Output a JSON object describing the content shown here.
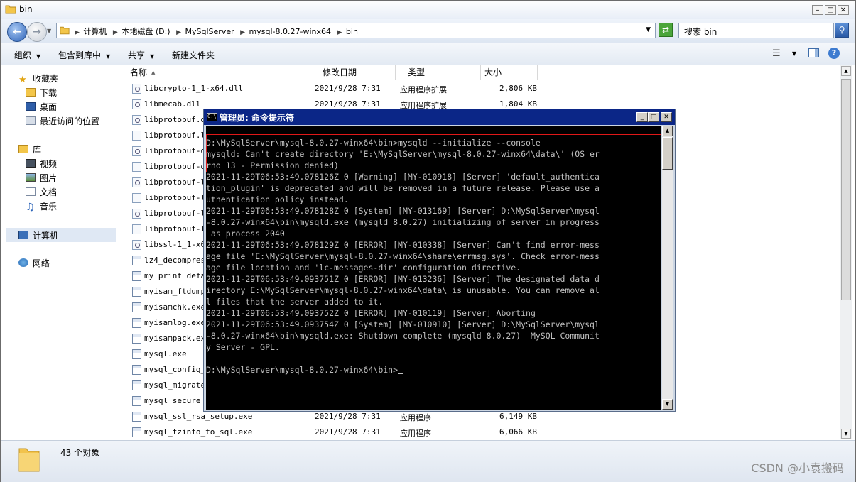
{
  "window": {
    "title": "bin",
    "controls": [
      "minimize",
      "maximize",
      "close"
    ]
  },
  "address_bar": {
    "breadcrumbs": [
      "计算机",
      "本地磁盘 (D:)",
      "MySqlServer",
      "mysql-8.0.27-winx64",
      "bin"
    ],
    "search_placeholder": "搜索 bin"
  },
  "toolbar": {
    "organize": "组织",
    "include_in_library": "包含到库中",
    "share": "共享",
    "new_folder": "新建文件夹"
  },
  "nav_pane": {
    "favorites": "收藏夹",
    "downloads": "下载",
    "desktop": "桌面",
    "recent": "最近访问的位置",
    "libraries": "库",
    "videos": "视频",
    "pictures": "图片",
    "documents": "文档",
    "music": "音乐",
    "computer": "计算机",
    "network": "网络"
  },
  "columns": {
    "name": "名称",
    "modified": "修改日期",
    "type": "类型",
    "size": "大小"
  },
  "files": [
    {
      "name": "libcrypto-1_1-x64.dll",
      "date": "2021/9/28 7:31",
      "type": "应用程序扩展",
      "size": "2,806 KB",
      "icon": "dll"
    },
    {
      "name": "libmecab.dll",
      "date": "2021/9/28 7:31",
      "type": "应用程序扩展",
      "size": "1,804 KB",
      "icon": "dll"
    },
    {
      "name": "libprotobuf.dl",
      "date": "",
      "type": "",
      "size": "",
      "icon": "dll"
    },
    {
      "name": "libprotobuf.li",
      "date": "",
      "type": "",
      "size": "",
      "icon": "file"
    },
    {
      "name": "libprotobuf-de",
      "date": "",
      "type": "",
      "size": "",
      "icon": "dll"
    },
    {
      "name": "libprotobuf-de",
      "date": "",
      "type": "",
      "size": "",
      "icon": "file"
    },
    {
      "name": "libprotobuf-li",
      "date": "",
      "type": "",
      "size": "",
      "icon": "dll"
    },
    {
      "name": "libprotobuf-li",
      "date": "",
      "type": "",
      "size": "",
      "icon": "file"
    },
    {
      "name": "libprotobuf-li",
      "date": "",
      "type": "",
      "size": "",
      "icon": "dll"
    },
    {
      "name": "libprotobuf-li",
      "date": "",
      "type": "",
      "size": "",
      "icon": "file"
    },
    {
      "name": "libssl-1_1-x6",
      "date": "",
      "type": "",
      "size": "",
      "icon": "dll"
    },
    {
      "name": "lz4_decompress",
      "date": "",
      "type": "",
      "size": "",
      "icon": "exe"
    },
    {
      "name": "my_print_defau",
      "date": "",
      "type": "",
      "size": "",
      "icon": "exe"
    },
    {
      "name": "myisam_ftdump.",
      "date": "",
      "type": "",
      "size": "",
      "icon": "exe"
    },
    {
      "name": "myisamchk.exe",
      "date": "",
      "type": "",
      "size": "",
      "icon": "exe"
    },
    {
      "name": "myisamlog.exe",
      "date": "",
      "type": "",
      "size": "",
      "icon": "exe"
    },
    {
      "name": "myisampack.exe",
      "date": "",
      "type": "",
      "size": "",
      "icon": "exe"
    },
    {
      "name": "mysql.exe",
      "date": "",
      "type": "",
      "size": "",
      "icon": "exe"
    },
    {
      "name": "mysql_config_e",
      "date": "",
      "type": "",
      "size": "",
      "icon": "exe"
    },
    {
      "name": "mysql_migrate_",
      "date": "",
      "type": "",
      "size": "",
      "icon": "exe"
    },
    {
      "name": "mysql_secure_i",
      "date": "",
      "type": "",
      "size": "",
      "icon": "exe"
    },
    {
      "name": "mysql_ssl_rsa_setup.exe",
      "date": "2021/9/28 7:31",
      "type": "应用程序",
      "size": "6,149 KB",
      "icon": "exe"
    },
    {
      "name": "mysql_tzinfo_to_sql.exe",
      "date": "2021/9/28 7:31",
      "type": "应用程序",
      "size": "6,066 KB",
      "icon": "exe"
    }
  ],
  "status": {
    "count": "43 个对象"
  },
  "watermark": "CSDN @小袁搬码",
  "cmd": {
    "title": "管理员: 命令提示符",
    "icon_label": "C:\\",
    "output": "D:\\MySqlServer\\mysql-8.0.27-winx64\\bin>mysqld --initialize --console\nmysqld: Can't create directory 'E:\\MySqlServer\\mysql-8.0.27-winx64\\data\\' (OS er\nrno 13 - Permission denied)\n2021-11-29T06:53:49.078126Z 0 [Warning] [MY-010918] [Server] 'default_authentica\ntion_plugin' is deprecated and will be removed in a future release. Please use a\nuthentication_policy instead.\n2021-11-29T06:53:49.078128Z 0 [System] [MY-013169] [Server] D:\\MySqlServer\\mysql\n-8.0.27-winx64\\bin\\mysqld.exe (mysqld 8.0.27) initializing of server in progress\n as process 2040\n2021-11-29T06:53:49.078129Z 0 [ERROR] [MY-010338] [Server] Can't find error-mess\nage file 'E:\\MySqlServer\\mysql-8.0.27-winx64\\share\\errmsg.sys'. Check error-mess\nage file location and 'lc-messages-dir' configuration directive.\n2021-11-29T06:53:49.093751Z 0 [ERROR] [MY-013236] [Server] The designated data d\nirectory E:\\MySqlServer\\mysql-8.0.27-winx64\\data\\ is unusable. You can remove al\nl files that the server added to it.\n2021-11-29T06:53:49.093752Z 0 [ERROR] [MY-010119] [Server] Aborting\n2021-11-29T06:53:49.093754Z 0 [System] [MY-010910] [Server] D:\\MySqlServer\\mysql\n-8.0.27-winx64\\bin\\mysqld.exe: Shutdown complete (mysqld 8.0.27)  MySQL Communit\ny Server - GPL.\n\nD:\\MySqlServer\\mysql-8.0.27-winx64\\bin>"
  },
  "colors": {
    "cmd_title_bar": "#0b2687",
    "highlight_box": "#e01818",
    "console_text": "#c0c0c0"
  }
}
